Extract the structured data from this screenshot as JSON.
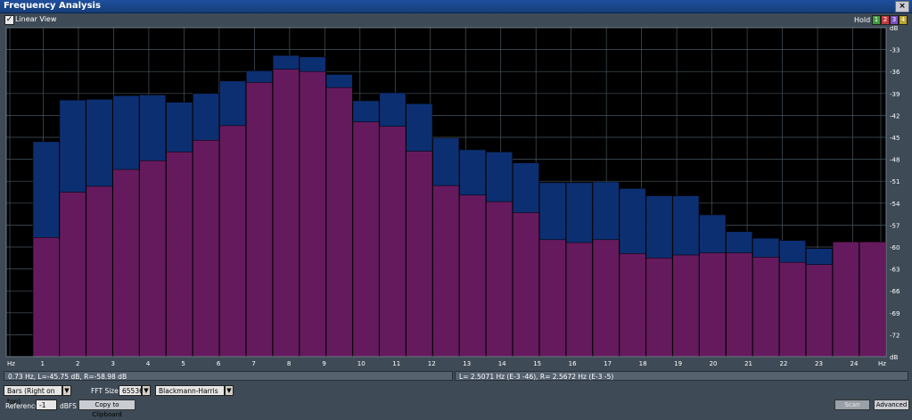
{
  "window": {
    "title": "Frequency Analysis",
    "close_glyph": "×"
  },
  "toolbar": {
    "linear_view_label": "Linear View",
    "linear_view_checked": true,
    "hold_label": "Hold",
    "hold_buttons": [
      {
        "label": "1",
        "color": "#3f9b3f"
      },
      {
        "label": "2",
        "color": "#c23b3b"
      },
      {
        "label": "3",
        "color": "#7a4fc0"
      },
      {
        "label": "4",
        "color": "#b8a531"
      }
    ]
  },
  "colors": {
    "plot_bg": "#000000",
    "grid": "#47555f",
    "left_channel": "#0c2f72",
    "right_channel": "#661a5e",
    "frame": "#3e4a55"
  },
  "chart_data": {
    "type": "bar",
    "x_unit": "Hz",
    "y_unit": "dB",
    "ylim": [
      -75,
      -30
    ],
    "y_ticks": [
      "dB",
      "-33",
      "-36",
      "-39",
      "-42",
      "-45",
      "-48",
      "-51",
      "-54",
      "-57",
      "-60",
      "-63",
      "-66",
      "-69",
      "-72",
      "dB"
    ],
    "x_ticks": [
      "Hz",
      "1",
      "2",
      "3",
      "4",
      "5",
      "6",
      "7",
      "8",
      "9",
      "10",
      "11",
      "12",
      "13",
      "14",
      "15",
      "16",
      "17",
      "18",
      "19",
      "20",
      "21",
      "22",
      "23",
      "24",
      "Hz"
    ],
    "series": [
      {
        "name": "L",
        "color": "#0c2f72",
        "values": [
          -45.6,
          -39.9,
          -39.8,
          -39.3,
          -39.2,
          -40.2,
          -39.0,
          -37.3,
          -35.9,
          -33.8,
          -34.0,
          -36.4,
          -40.0,
          -38.9,
          -40.4,
          -45.1,
          -46.7,
          -47.0,
          -48.5,
          -51.2,
          -51.2,
          -51.1,
          -52.0,
          -53.0,
          -53.0,
          -55.6,
          -57.9,
          -58.8,
          -59.1,
          -60.2,
          -60.3,
          -60.8
        ]
      },
      {
        "name": "R",
        "color": "#661a5e",
        "values": [
          -58.7,
          -52.5,
          -51.7,
          -49.4,
          -48.2,
          -47.0,
          -45.4,
          -43.4,
          -37.5,
          -35.7,
          -36.0,
          -38.2,
          -42.9,
          -43.5,
          -46.9,
          -51.6,
          -52.9,
          -53.8,
          -55.3,
          -59.0,
          -59.4,
          -59.0,
          -60.9,
          -61.5,
          -61.1,
          -60.8,
          -60.8,
          -61.4,
          -62.1,
          -62.4,
          -59.3,
          -59.3
        ]
      }
    ]
  },
  "status": {
    "left": "0.73 Hz, L=-45.75 dB, R=-58.98 dB",
    "right": "L= 2.5071 Hz (E-3 -46), R= 2.5672 Hz (E-3 -5)"
  },
  "controls": {
    "view_mode": "Bars (Right on top)",
    "fft_size_label": "FFT Size",
    "fft_size": "65536",
    "window_function": "Blackmann-Harris",
    "reference_label": "Reference",
    "reference_value": "-1",
    "reference_unit": "dBFS",
    "copy_button": "Copy to Clipboard",
    "scan_button": "Scan",
    "advanced_button": "Advanced"
  }
}
